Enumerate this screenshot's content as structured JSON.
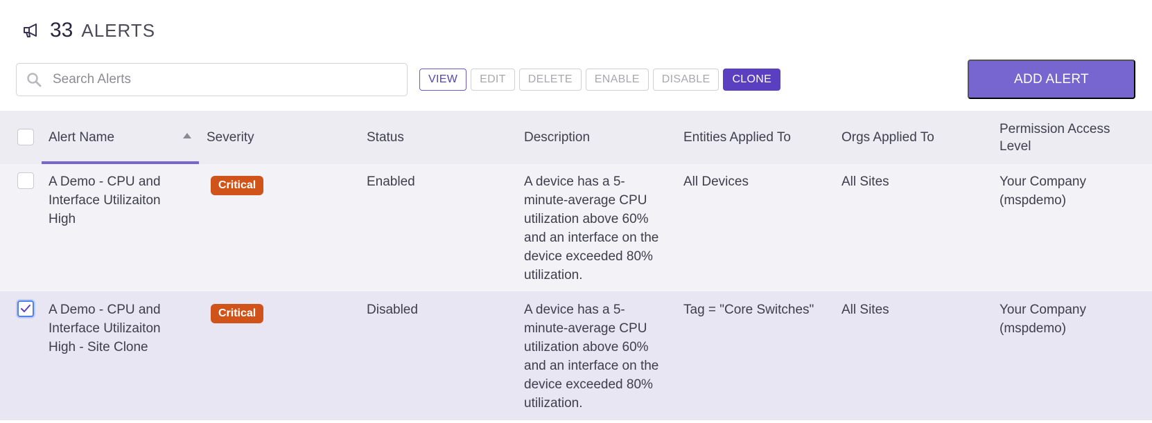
{
  "header": {
    "count": "33",
    "title": "ALERTS",
    "icon": "megaphone-icon"
  },
  "search": {
    "placeholder": "Search Alerts",
    "value": ""
  },
  "actions": {
    "view": "VIEW",
    "edit": "EDIT",
    "delete": "DELETE",
    "enable": "ENABLE",
    "disable": "DISABLE",
    "clone": "CLONE"
  },
  "add_button": "ADD ALERT",
  "columns": [
    "Alert Name",
    "Severity",
    "Status",
    "Description",
    "Entities Applied To",
    "Orgs Applied To",
    "Permission Access Level"
  ],
  "sort": {
    "column": "Alert Name",
    "direction": "ascending"
  },
  "rows": [
    {
      "checked": false,
      "name": "A Demo - CPU and Interface Utilizaiton High",
      "severity": "Critical",
      "status": "Enabled",
      "description": "A device has a 5-minute-average CPU utilization above 60% and an interface on the device exceeded 80% utilization.",
      "entities": "All Devices",
      "orgs": "All Sites",
      "permission": "Your Company (mspdemo)"
    },
    {
      "checked": true,
      "name": "A Demo - CPU and Interface Utilizaiton High - Site Clone",
      "severity": "Critical",
      "status": "Disabled",
      "description": "A device has a 5-minute-average CPU utilization above 60% and an interface on the device exceeded 80% utilization.",
      "entities": "Tag = \"Core Switches\"",
      "orgs": "All Sites",
      "permission": "Your Company (mspdemo)"
    }
  ],
  "colors": {
    "accent": "#7766cf",
    "clone": "#5a3fc0",
    "critical": "#d0541a",
    "selected_row": "#e9e6f4"
  }
}
